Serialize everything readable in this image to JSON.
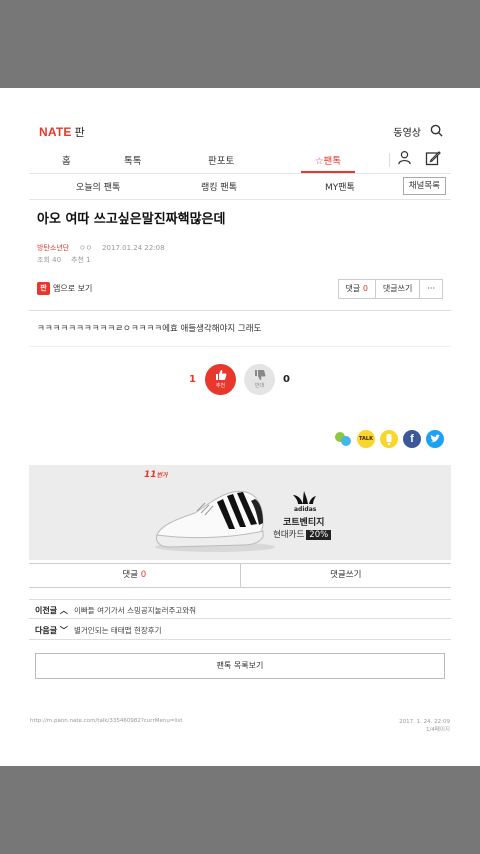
{
  "header": {
    "logo": "NATE",
    "logo_sub": "판",
    "video_link": "동영상"
  },
  "gnb": {
    "tabs": [
      "홈",
      "톡톡",
      "판포토",
      "팬톡"
    ],
    "active_tab": "팬톡"
  },
  "subnav": {
    "items": [
      "오늘의 팬톡",
      "랭킹 팬톡",
      "MY팬톡"
    ],
    "channel_button": "채널목록"
  },
  "post": {
    "title": "아오 여따 쓰고싶은말진짜핵많은데",
    "author": "방탄소년단",
    "author_mark": "ㅇㅇ",
    "date": "2017.01.24 22:08",
    "views_label": "조회",
    "views": "40",
    "recommend_label": "추천",
    "recommend": "1",
    "body": "ㅋㅋㅋㅋㅋㅋㅋㅋㅋㅋㄹㅇㅋㅋㅋㅋ에효 애들생각해야지 그래도"
  },
  "appbar": {
    "app_icon": "판",
    "app_label": "앱으로 보기",
    "comment_label": "댓글",
    "comment_count": "0",
    "write_comment": "댓글쓰기",
    "more": "···"
  },
  "vote": {
    "up_count": "1",
    "up_label": "추천",
    "down_count": "0",
    "down_label": "반대"
  },
  "share": {
    "kakaotalk_text": "TALK"
  },
  "ad": {
    "badge": "11",
    "badge_sub": "번가",
    "brand": "adidas",
    "title": "코트벤티지",
    "card": "현대카드",
    "discount": "20%"
  },
  "comment_bar": {
    "comment_label": "댓글",
    "comment_count": "0",
    "write_label": "댓글쓰기"
  },
  "navigation": {
    "prev_label": "이전글",
    "prev_title": "이빠들 여기가서 스밍공지눌러주고와줘",
    "next_label": "다음글",
    "next_title": "별거인되는 태태맵 현장후기"
  },
  "list_button": "팬톡 목록보기",
  "footer": {
    "url": "http://m.pann.nate.com/talk/335460982?currMenu=list",
    "date": "2017. 1. 24. 22:09",
    "page": "1/4페이지"
  },
  "colors": {
    "accent": "#e8372c",
    "kakao_yellow": "#f9d62e",
    "facebook": "#3b5998",
    "twitter": "#1da1f2"
  }
}
